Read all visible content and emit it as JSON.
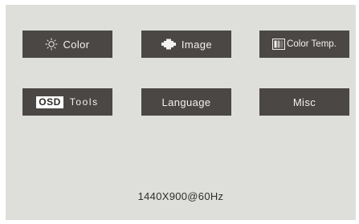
{
  "menu": {
    "color_label": "Color",
    "image_label": "Image",
    "color_temp_label": "Color Temp.",
    "osd_badge": "OSD",
    "tools_label": "Tools",
    "language_label": "Language",
    "misc_label": "Misc"
  },
  "icons": {
    "color": "sun-icon",
    "image": "picture-chip-icon",
    "color_temp": "color-temperature-icon"
  },
  "status": {
    "resolution": "1440X900@60Hz"
  },
  "colors": {
    "background": "#dedfda",
    "tile": "#4a4744",
    "tile_text": "#f2f2f0"
  }
}
